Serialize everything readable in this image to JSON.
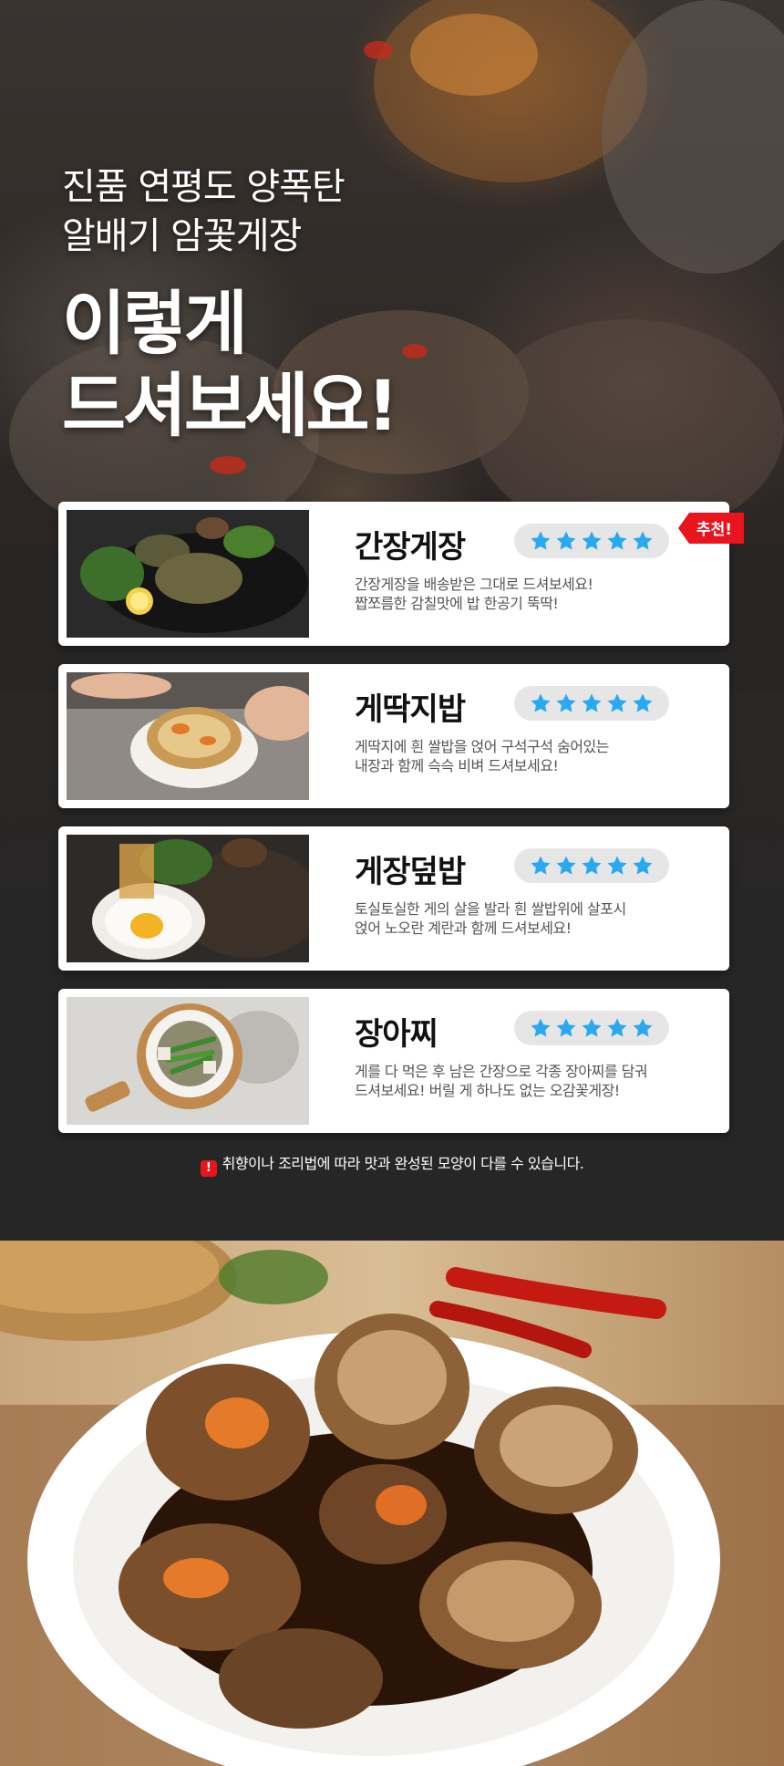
{
  "hero": {
    "subtitle_line1": "진품 연평도 양폭탄",
    "subtitle_line2": "알배기 암꽃게장",
    "title_line1": "이렇게",
    "title_line2": "드셔보세요!"
  },
  "badge": {
    "label": "추천!",
    "color": "#e8141e"
  },
  "accent": {
    "star_color": "#2aa9f0"
  },
  "cards": [
    {
      "name": "간장게장",
      "rating": 5,
      "desc_line1": "간장게장을 배송받은 그대로 드셔보세요!",
      "desc_line2": "짭쪼름한 감칠맛에 밥 한공기 뚝딱!"
    },
    {
      "name": "게딱지밥",
      "rating": 5,
      "desc_line1": "게딱지에 흰 쌀밥을 얹어 구석구석 숨어있는",
      "desc_line2": "내장과 함께 슥슥 비벼 드셔보세요!"
    },
    {
      "name": "게장덮밥",
      "rating": 5,
      "desc_line1": "토실토실한 게의 살을 발라 흰 쌀밥위에 살포시",
      "desc_line2": "얹어 노오란 계란과 함께 드셔보세요!"
    },
    {
      "name": "장아찌",
      "rating": 5,
      "desc_line1": "게를 다 먹은 후 남은 간장으로 각종 장아찌를 담궈",
      "desc_line2": "드셔보세요! 버릴 게 하나도 없는 오감꽃게장!"
    }
  ],
  "notice": {
    "icon": "exclamation-icon",
    "text": "취향이나 조리법에 따라 맛과 완성된 모양이 다를 수 있습니다."
  }
}
